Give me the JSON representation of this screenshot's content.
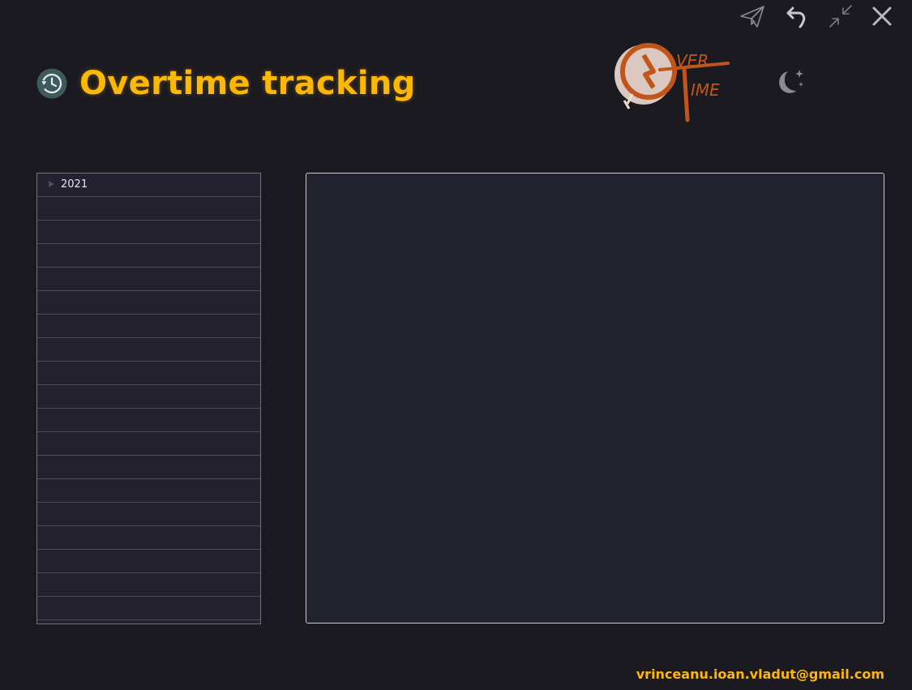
{
  "app": {
    "title": "Overtime tracking",
    "accent_color": "#fdb705",
    "background_color": "#1b1a20",
    "title_icon": "history-clock-icon"
  },
  "window_controls": [
    {
      "name": "send-icon"
    },
    {
      "name": "undo-icon"
    },
    {
      "name": "shrink-icon"
    },
    {
      "name": "close-icon"
    }
  ],
  "logo": {
    "name": "overtime-logo",
    "text_top": "VER",
    "text_bottom": "IME",
    "color": "#c2561a"
  },
  "theme_toggle": {
    "icon": "moon-stars-icon"
  },
  "tree": {
    "border_color": "#1b8fbf",
    "items": [
      {
        "label": "2021",
        "expandable": true
      }
    ]
  },
  "footer": {
    "email": "vrinceanu.ioan.vladut@gmail.com"
  }
}
